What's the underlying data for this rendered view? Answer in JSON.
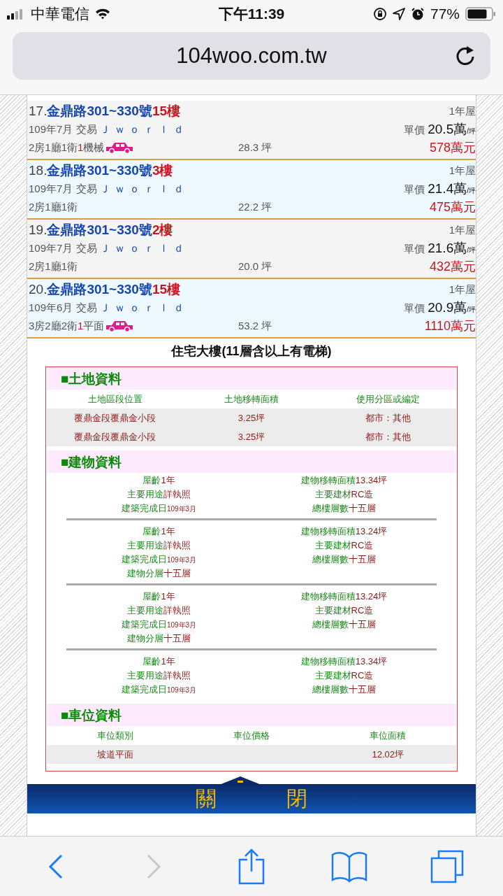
{
  "status_bar": {
    "carrier": "中華電信",
    "time": "下午11:39",
    "battery": "77%"
  },
  "address_bar": {
    "url": "104woo.com.tw"
  },
  "listings": [
    {
      "number": "17.",
      "street": "金鼎路301~330號",
      "floor": "15樓",
      "age": "1年屋",
      "date": "109年7月",
      "trade": "交易",
      "agent": "Ｊｗｏｒｌｄ",
      "unit_label": "單價",
      "unit_price": "20.5萬",
      "unit": "/坪",
      "layout": "2房1廳1衛",
      "parking_count": "1",
      "parking_type": "機械",
      "area": "28.3 坪",
      "total": "578萬元"
    },
    {
      "number": "18.",
      "street": "金鼎路301~330號",
      "floor": "3樓",
      "age": "1年屋",
      "date": "109年7月",
      "trade": "交易",
      "agent": "Ｊｗｏｒｌｄ",
      "unit_label": "單價",
      "unit_price": "21.4萬",
      "unit": "/坪",
      "layout": "2房1廳1衛",
      "area": "22.2 坪",
      "total": "475萬元"
    },
    {
      "number": "19.",
      "street": "金鼎路301~330號",
      "floor": "2樓",
      "age": "1年屋",
      "date": "109年7月",
      "trade": "交易",
      "agent": "Ｊｗｏｒｌｄ",
      "unit_label": "單價",
      "unit_price": "21.6萬",
      "unit": "/坪",
      "layout": "2房1廳1衛",
      "area": "20.0 坪",
      "total": "432萬元"
    },
    {
      "number": "20.",
      "street": "金鼎路301~330號",
      "floor": "15樓",
      "age": "1年屋",
      "date": "109年6月",
      "trade": "交易",
      "agent": "Ｊｗｏｒｌｄ",
      "unit_label": "單價",
      "unit_price": "20.9萬",
      "unit": "/坪",
      "layout": "3房2廳2衛",
      "parking_count": "1",
      "parking_type": "平面",
      "area": "53.2 坪",
      "total": "1110萬元"
    }
  ],
  "detail": {
    "title": "住宅大樓(11層含以上有電梯)",
    "land": {
      "heading": "■土地資料",
      "columns": [
        "土地區段位置",
        "土地移轉面積",
        "使用分區或編定"
      ],
      "rows": [
        [
          "覆鼎金段覆鼎金小段",
          "3.25坪",
          "都市：其他"
        ],
        [
          "覆鼎金段覆鼎金小段",
          "3.25坪",
          "都市：其他"
        ]
      ]
    },
    "building": {
      "heading": "■建物資料",
      "groups": [
        {
          "left": [
            {
              "label": "屋齡",
              "value": "1年"
            },
            {
              "label": "主要用途",
              "value": "詳執照"
            },
            {
              "label": "建築完成日",
              "value": "109年3月"
            }
          ],
          "right": [
            {
              "label": "建物移轉面積",
              "value": "13.34坪"
            },
            {
              "label": "主要建材",
              "value": "RC造"
            },
            {
              "label": "總樓層數",
              "value": "十五層"
            }
          ]
        },
        {
          "left": [
            {
              "label": "屋齡",
              "value": "1年"
            },
            {
              "label": "主要用途",
              "value": "詳執照"
            },
            {
              "label": "建築完成日",
              "value": "109年3月"
            },
            {
              "label": "建物分層",
              "value": "十五層"
            }
          ],
          "right": [
            {
              "label": "建物移轉面積",
              "value": "13.24坪"
            },
            {
              "label": "主要建材",
              "value": "RC造"
            },
            {
              "label": "總樓層數",
              "value": "十五層"
            }
          ]
        },
        {
          "left": [
            {
              "label": "屋齡",
              "value": "1年"
            },
            {
              "label": "主要用途",
              "value": "詳執照"
            },
            {
              "label": "建築完成日",
              "value": "109年3月"
            },
            {
              "label": "建物分層",
              "value": "十五層"
            }
          ],
          "right": [
            {
              "label": "建物移轉面積",
              "value": "13.24坪"
            },
            {
              "label": "主要建材",
              "value": "RC造"
            },
            {
              "label": "總樓層數",
              "value": "十五層"
            }
          ]
        },
        {
          "left": [
            {
              "label": "屋齡",
              "value": "1年"
            },
            {
              "label": "主要用途",
              "value": "詳執照"
            },
            {
              "label": "建築完成日",
              "value": "109年3月"
            }
          ],
          "right": [
            {
              "label": "建物移轉面積",
              "value": "13.34坪"
            },
            {
              "label": "主要建材",
              "value": "RC造"
            },
            {
              "label": "總樓層數",
              "value": "十五層"
            }
          ]
        }
      ]
    },
    "parking": {
      "heading": "■車位資料",
      "columns": [
        "車位類別",
        "車位價格",
        "車位面積"
      ],
      "rows": [
        [
          "坡道平面",
          "",
          "12.02坪"
        ]
      ]
    }
  },
  "close_button": "關 閉",
  "toolbar": [
    {
      "kind": "back",
      "disabled": false
    },
    {
      "kind": "forward",
      "disabled": true
    },
    {
      "kind": "share",
      "disabled": false
    },
    {
      "kind": "bookmarks",
      "disabled": false
    },
    {
      "kind": "tabs",
      "disabled": false
    }
  ]
}
